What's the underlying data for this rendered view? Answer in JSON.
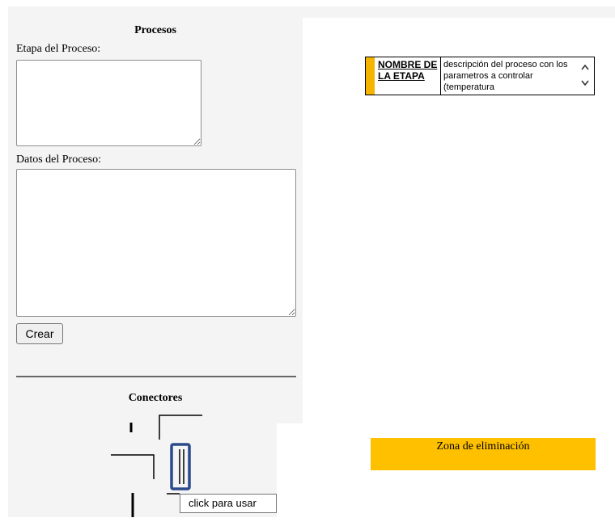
{
  "procesos": {
    "title": "Procesos",
    "etapa_label": "Etapa del Proceso:",
    "etapa_value": "",
    "datos_label": "Datos del Proceso:",
    "datos_value": "",
    "crear_label": "Crear"
  },
  "conectores": {
    "title": "Conectores",
    "tooltip": "click para usar"
  },
  "stage_card": {
    "name": "NOMBRE DE LA ETAPA",
    "description": "descripción del proceso con los parametros a controlar (temperatura"
  },
  "delete_zone": {
    "label": "Zona de eliminación"
  },
  "colors": {
    "panel": "#f4f4f4",
    "accent": "#ffc000",
    "selection": "#2b4a8b"
  }
}
